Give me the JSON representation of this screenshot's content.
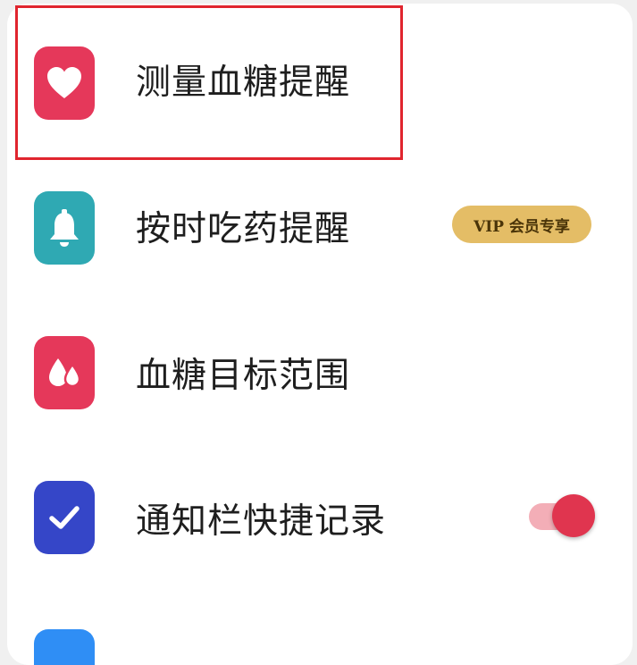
{
  "settings": {
    "items": [
      {
        "label": "测量血糖提醒",
        "icon": "heart-icon",
        "icon_bg": "#e5385a"
      },
      {
        "label": "按时吃药提醒",
        "icon": "bell-icon",
        "icon_bg": "#2fa9b3",
        "badge": "VIP 会员专享"
      },
      {
        "label": "血糖目标范围",
        "icon": "droplets-icon",
        "icon_bg": "#e5385a"
      },
      {
        "label": "通知栏快捷记录",
        "icon": "checkmark-icon",
        "icon_bg": "#3546c8",
        "toggle_on": true
      }
    ],
    "colors": {
      "highlight": "#e0252e",
      "toggle_track": "#f3aeb7",
      "toggle_knob": "#e0354f",
      "badge_bg": "#e4bd66",
      "partial_icon": "#2f8ef5"
    }
  }
}
